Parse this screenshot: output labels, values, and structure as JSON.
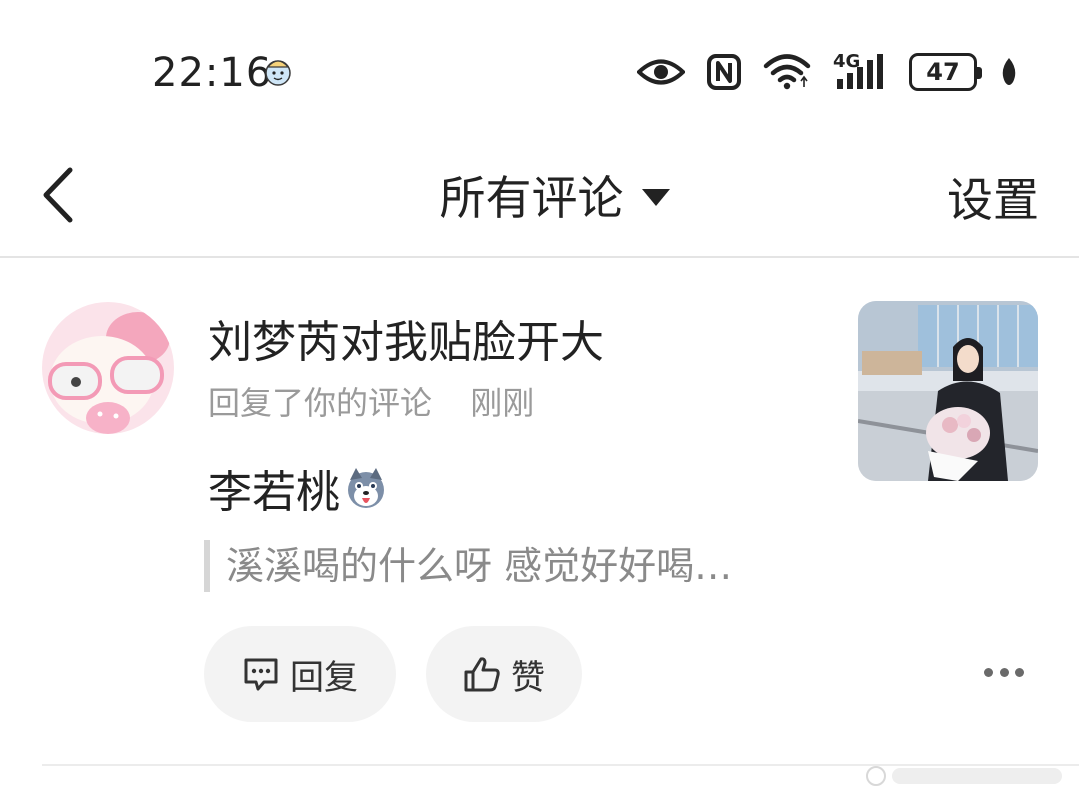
{
  "status_bar": {
    "time": "22:16",
    "battery": "47",
    "network": "4G",
    "icons": [
      "avatar-icon",
      "eye-icon",
      "nfc-icon",
      "wifi-icon",
      "signal-icon",
      "battery-icon",
      "leaf-icon"
    ]
  },
  "nav": {
    "title": "所有评论",
    "settings_label": "设置"
  },
  "comment": {
    "username": "刘梦芮对我贴脸开大",
    "action": "回复了你的评论",
    "time": "刚刚",
    "text": "李若桃",
    "quoted": "溪溪喝的什么呀 感觉好好喝…",
    "reply_label": "回复",
    "like_label": "赞"
  },
  "colors": {
    "text": "#222222",
    "meta": "#9a9a9a",
    "button_bg": "#f3f3f3",
    "divider": "#e4e4e4"
  }
}
